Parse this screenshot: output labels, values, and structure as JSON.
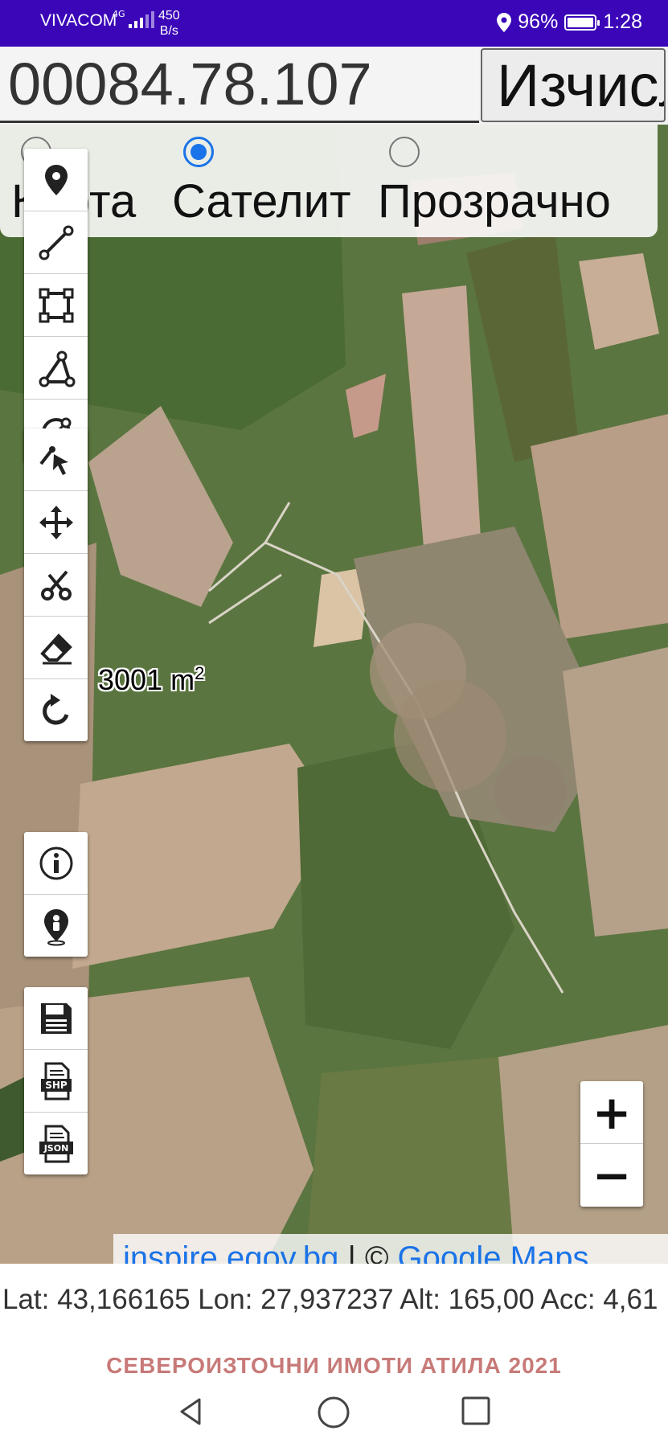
{
  "status_bar": {
    "carrier": "VIVACOM",
    "network": "4G",
    "speed_value": "450",
    "speed_unit": "B/s",
    "battery": "96%",
    "time": "1:28"
  },
  "search": {
    "parcel_id": "00084.78.107",
    "calc_button_label": "Изчисли"
  },
  "layers": {
    "options": [
      {
        "label": "Карта",
        "selected": false
      },
      {
        "label": "Сателит",
        "selected": true
      },
      {
        "label": "Прозрачно",
        "selected": false
      }
    ]
  },
  "map": {
    "area_value": "3001 m",
    "area_unit_power": "2",
    "attribution_link1": "inspire.egov.bg",
    "attribution_sep": " | © ",
    "attribution_link2": "Google Maps"
  },
  "zoom": {
    "in": "+",
    "out": "−"
  },
  "tools": {
    "draw_group": [
      "marker-icon",
      "line-icon",
      "rectangle-icon",
      "polygon-icon",
      "circle-icon"
    ],
    "edit_group": [
      "select-icon",
      "move-icon",
      "cut-icon",
      "eraser-icon",
      "rotate-icon"
    ],
    "info_group": [
      "info-icon",
      "locate-me-icon"
    ],
    "export_group": [
      "save-icon",
      "shp-export-icon",
      "json-export-icon"
    ],
    "shp_label": "SHP",
    "json_label": "JSON"
  },
  "location": {
    "text": "Lat: 43,166165 Lon: 27,937237 Alt: 165,00 Acc: 4,61"
  },
  "footer": {
    "title": "СЕВЕРОИЗТОЧНИ ИМОТИ АТИЛА 2021"
  },
  "colors": {
    "status_bar": "#3a06b8",
    "accent": "#1a73e8",
    "footer_title": "#c77a78"
  }
}
